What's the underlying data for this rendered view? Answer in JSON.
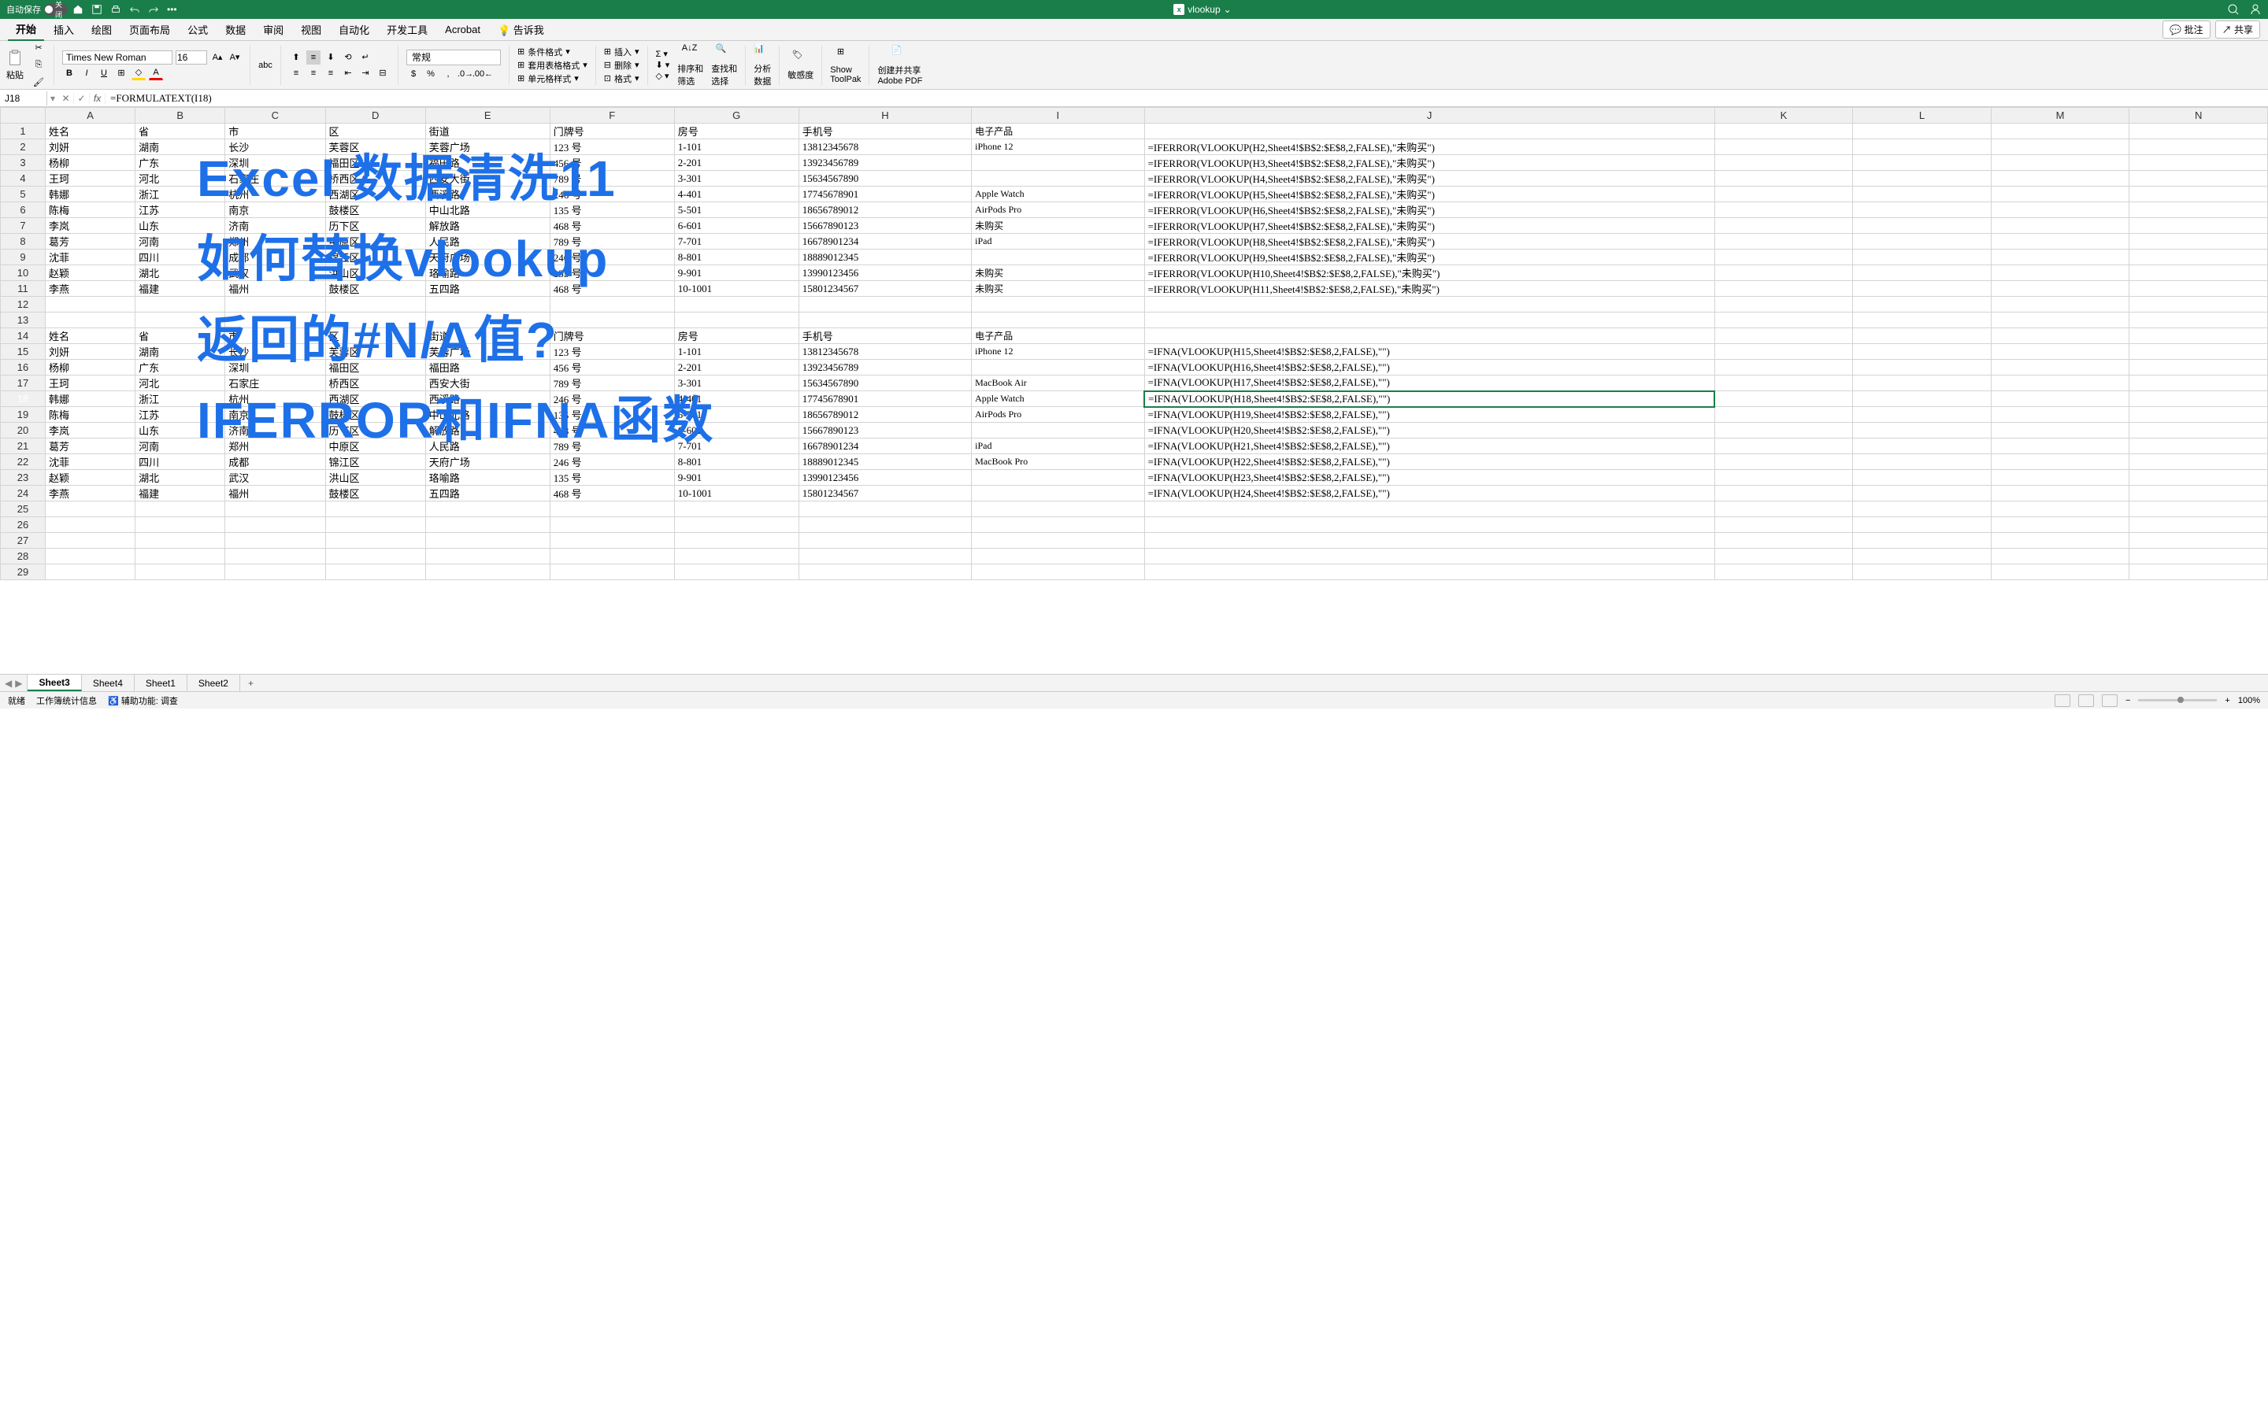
{
  "title_bar": {
    "autosave_label": "自动保存",
    "toggle": "关闭",
    "file_name": "vlookup"
  },
  "ribbon": {
    "tabs": [
      "开始",
      "插入",
      "绘图",
      "页面布局",
      "公式",
      "数据",
      "审阅",
      "视图",
      "自动化",
      "开发工具",
      "Acrobat"
    ],
    "tell_me": "告诉我",
    "share": "共享",
    "comments": "批注",
    "paste_label": "粘贴",
    "font_name": "Times New Roman",
    "font_size": "16",
    "num_format": "常规",
    "cond_fmt": "条件格式",
    "table_fmt": "套用表格格式",
    "cell_style": "单元格样式",
    "insert": "插入",
    "delete": "删除",
    "format": "格式",
    "sort_filter": "排序和\n筛选",
    "find_select": "查找和\n选择",
    "analyze": "分析\n数据",
    "sensitivity": "敏感度",
    "toolpak": "Show\nToolPak",
    "adobe": "创建并共享\nAdobe PDF"
  },
  "formula_bar": {
    "name_box": "J18",
    "formula": "=FORMULATEXT(I18)"
  },
  "columns": [
    "",
    "A",
    "B",
    "C",
    "D",
    "E",
    "F",
    "G",
    "H",
    "I",
    "J",
    "K",
    "L",
    "M",
    "N"
  ],
  "header_row": [
    "姓名",
    "省",
    "市",
    "区",
    "街道",
    "门牌号",
    "房号",
    "手机号",
    "电子产品",
    "",
    ""
  ],
  "data_rows_1": [
    [
      "刘妍",
      "湖南",
      "长沙",
      "芙蓉区",
      "芙蓉广场",
      "123 号",
      "1-101",
      "13812345678",
      "iPhone 12",
      "=IFERROR(VLOOKUP(H2,Sheet4!$B$2:$E$8,2,FALSE),\"未购买\")"
    ],
    [
      "杨柳",
      "广东",
      "深圳",
      "福田区",
      "福田路",
      "456 号",
      "2-201",
      "13923456789",
      "",
      "=IFERROR(VLOOKUP(H3,Sheet4!$B$2:$E$8,2,FALSE),\"未购买\")"
    ],
    [
      "王珂",
      "河北",
      "石家庄",
      "桥西区",
      "西安大街",
      "789 号",
      "3-301",
      "15634567890",
      "",
      "=IFERROR(VLOOKUP(H4,Sheet4!$B$2:$E$8,2,FALSE),\"未购买\")"
    ],
    [
      "韩娜",
      "浙江",
      "杭州",
      "西湖区",
      "西溪路",
      "246 号",
      "4-401",
      "17745678901",
      "Apple Watch",
      "=IFERROR(VLOOKUP(H5,Sheet4!$B$2:$E$8,2,FALSE),\"未购买\")"
    ],
    [
      "陈梅",
      "江苏",
      "南京",
      "鼓楼区",
      "中山北路",
      "135 号",
      "5-501",
      "18656789012",
      "AirPods Pro",
      "=IFERROR(VLOOKUP(H6,Sheet4!$B$2:$E$8,2,FALSE),\"未购买\")"
    ],
    [
      "李岚",
      "山东",
      "济南",
      "历下区",
      "解放路",
      "468 号",
      "6-601",
      "15667890123",
      "未购买",
      "=IFERROR(VLOOKUP(H7,Sheet4!$B$2:$E$8,2,FALSE),\"未购买\")"
    ],
    [
      "葛芳",
      "河南",
      "郑州",
      "中原区",
      "人民路",
      "789 号",
      "7-701",
      "16678901234",
      "iPad",
      "=IFERROR(VLOOKUP(H8,Sheet4!$B$2:$E$8,2,FALSE),\"未购买\")"
    ],
    [
      "沈菲",
      "四川",
      "成都",
      "锦江区",
      "天府广场",
      "246 号",
      "8-801",
      "18889012345",
      "",
      "=IFERROR(VLOOKUP(H9,Sheet4!$B$2:$E$8,2,FALSE),\"未购买\")"
    ],
    [
      "赵颖",
      "湖北",
      "武汉",
      "洪山区",
      "珞喻路",
      "135 号",
      "9-901",
      "13990123456",
      "未购买",
      "=IFERROR(VLOOKUP(H10,Sheet4!$B$2:$E$8,2,FALSE),\"未购买\")"
    ],
    [
      "李燕",
      "福建",
      "福州",
      "鼓楼区",
      "五四路",
      "468 号",
      "10-1001",
      "15801234567",
      "未购买",
      "=IFERROR(VLOOKUP(H11,Sheet4!$B$2:$E$8,2,FALSE),\"未购买\")"
    ]
  ],
  "data_rows_2": [
    [
      "刘妍",
      "湖南",
      "长沙",
      "芙蓉区",
      "芙蓉广场",
      "123 号",
      "1-101",
      "13812345678",
      "iPhone 12",
      "=IFNA(VLOOKUP(H15,Sheet4!$B$2:$E$8,2,FALSE),\"\")"
    ],
    [
      "杨柳",
      "广东",
      "深圳",
      "福田区",
      "福田路",
      "456 号",
      "2-201",
      "13923456789",
      "",
      "=IFNA(VLOOKUP(H16,Sheet4!$B$2:$E$8,2,FALSE),\"\")"
    ],
    [
      "王珂",
      "河北",
      "石家庄",
      "桥西区",
      "西安大街",
      "789 号",
      "3-301",
      "15634567890",
      "MacBook Air",
      "=IFNA(VLOOKUP(H17,Sheet4!$B$2:$E$8,2,FALSE),\"\")"
    ],
    [
      "韩娜",
      "浙江",
      "杭州",
      "西湖区",
      "西溪路",
      "246 号",
      "4-401",
      "17745678901",
      "Apple Watch",
      "=IFNA(VLOOKUP(H18,Sheet4!$B$2:$E$8,2,FALSE),\"\")"
    ],
    [
      "陈梅",
      "江苏",
      "南京",
      "鼓楼区",
      "中山北路",
      "135 号",
      "5-501",
      "18656789012",
      "AirPods Pro",
      "=IFNA(VLOOKUP(H19,Sheet4!$B$2:$E$8,2,FALSE),\"\")"
    ],
    [
      "李岚",
      "山东",
      "济南",
      "历下区",
      "解放路",
      "468 号",
      "6-601",
      "15667890123",
      "",
      "=IFNA(VLOOKUP(H20,Sheet4!$B$2:$E$8,2,FALSE),\"\")"
    ],
    [
      "葛芳",
      "河南",
      "郑州",
      "中原区",
      "人民路",
      "789 号",
      "7-701",
      "16678901234",
      "iPad",
      "=IFNA(VLOOKUP(H21,Sheet4!$B$2:$E$8,2,FALSE),\"\")"
    ],
    [
      "沈菲",
      "四川",
      "成都",
      "锦江区",
      "天府广场",
      "246 号",
      "8-801",
      "18889012345",
      "MacBook Pro",
      "=IFNA(VLOOKUP(H22,Sheet4!$B$2:$E$8,2,FALSE),\"\")"
    ],
    [
      "赵颖",
      "湖北",
      "武汉",
      "洪山区",
      "珞喻路",
      "135 号",
      "9-901",
      "13990123456",
      "",
      "=IFNA(VLOOKUP(H23,Sheet4!$B$2:$E$8,2,FALSE),\"\")"
    ],
    [
      "李燕",
      "福建",
      "福州",
      "鼓楼区",
      "五四路",
      "468 号",
      "10-1001",
      "15801234567",
      "",
      "=IFNA(VLOOKUP(H24,Sheet4!$B$2:$E$8,2,FALSE),\"\")"
    ]
  ],
  "overlay_lines": [
    "Excel 数据清洗11",
    "如何替换vlookup",
    "返回的#N/A值?",
    "IFERROR和IFNA函数"
  ],
  "sheets": [
    "Sheet3",
    "Sheet4",
    "Sheet1",
    "Sheet2"
  ],
  "active_sheet": 0,
  "status": {
    "ready": "就绪",
    "stats": "工作簿统计信息",
    "accessibility": "辅助功能: 调查",
    "zoom": "100%"
  }
}
